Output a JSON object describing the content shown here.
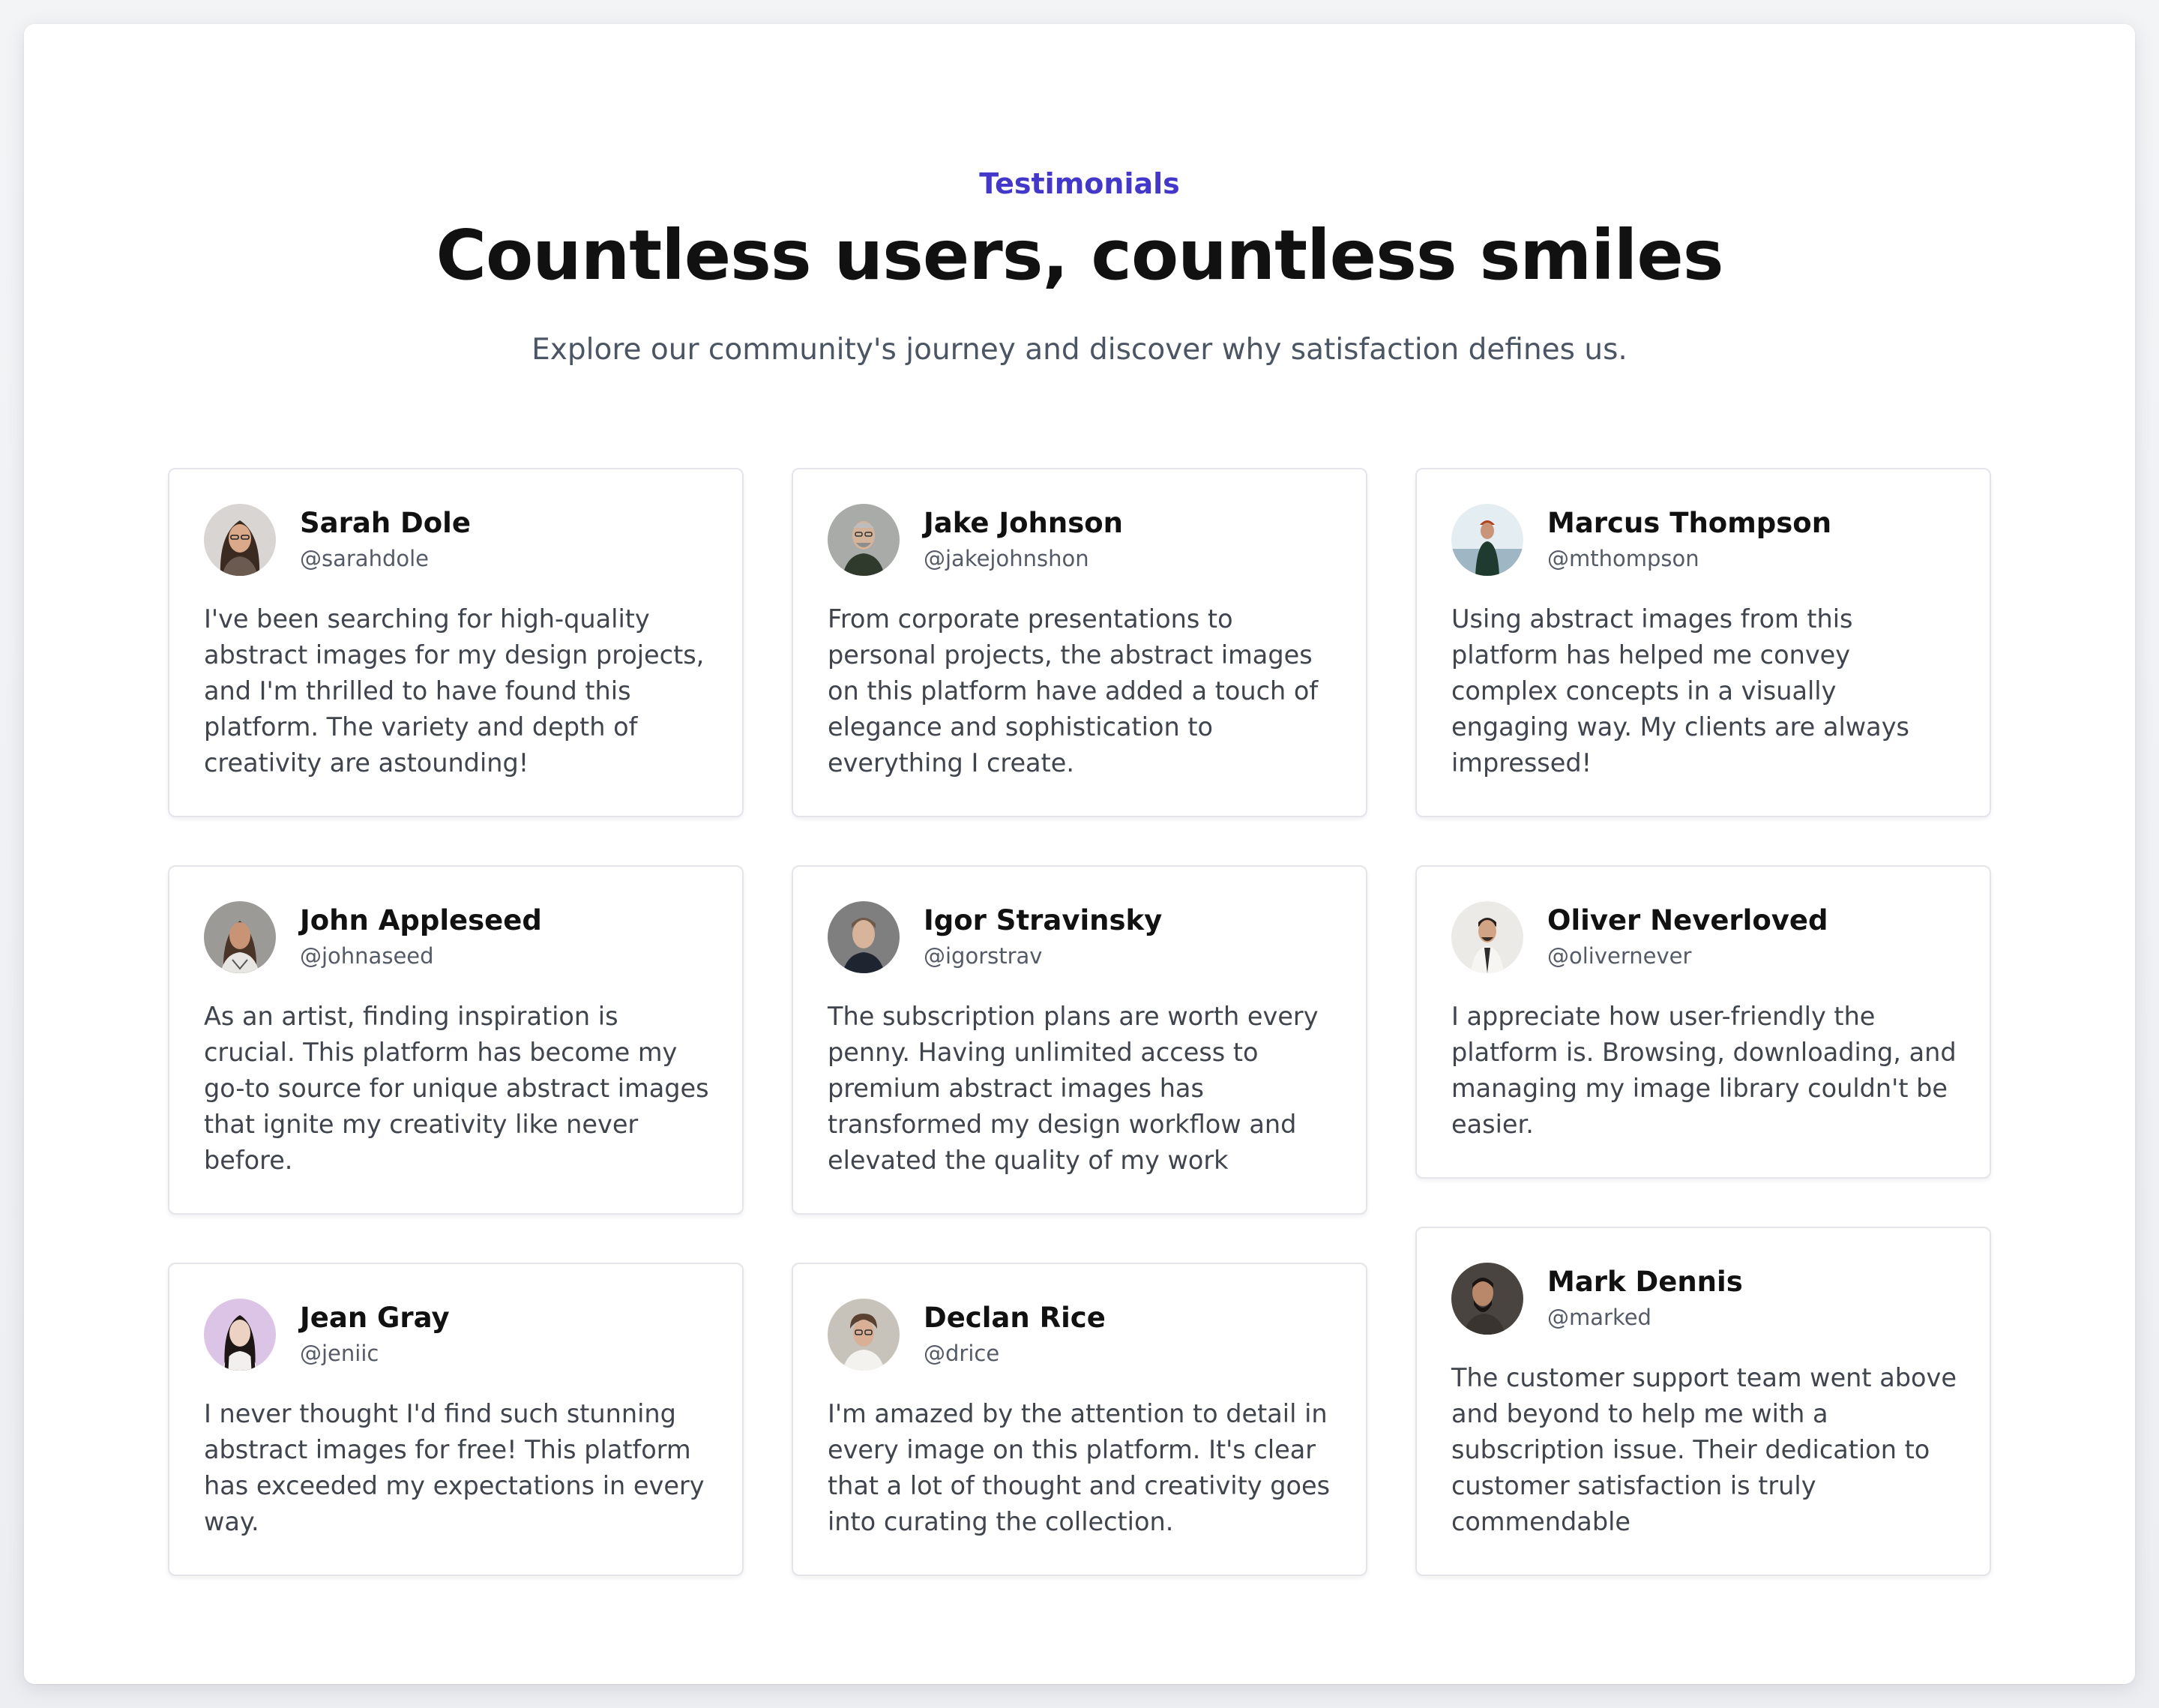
{
  "header": {
    "eyebrow": "Testimonials",
    "title": "Countless users, countless smiles",
    "subtitle": "Explore our community's journey and discover why satisfaction defines us."
  },
  "colors": {
    "accent": "#4338ca",
    "heading": "#111111",
    "body_text": "#3f444d",
    "card_border": "#e3e5ea"
  },
  "testimonials": [
    {
      "name": "Sarah Dole",
      "handle": "@sarahdole",
      "quote": "I've been searching for high-quality abstract images for my design projects, and I'm thrilled to have found this platform. The variety and depth of creativity are astounding!",
      "avatar_icon": "avatar-photo-icon"
    },
    {
      "name": "John Appleseed",
      "handle": "@johnaseed",
      "quote": "As an artist, finding inspiration is crucial. This platform has become my go-to source for unique abstract images that ignite my creativity like never before.",
      "avatar_icon": "avatar-photo-icon"
    },
    {
      "name": "Jean Gray",
      "handle": "@jeniic",
      "quote": "I never thought I'd find such stunning abstract images for free! This platform has exceeded my expectations in every way.",
      "avatar_icon": "avatar-photo-icon"
    },
    {
      "name": "Jake Johnson",
      "handle": "@jakejohnshon",
      "quote": "From corporate presentations to personal projects, the abstract images on this platform have added a touch of elegance and sophistication to everything I create.",
      "avatar_icon": "avatar-photo-icon"
    },
    {
      "name": "Igor Stravinsky",
      "handle": "@igorstrav",
      "quote": "The subscription plans are worth every penny. Having unlimited access to premium abstract images has transformed my design workflow and elevated the quality of my work",
      "avatar_icon": "avatar-photo-icon"
    },
    {
      "name": "Declan Rice",
      "handle": "@drice",
      "quote": "I'm amazed by the attention to detail in every image on this platform. It's clear that a lot of thought and creativity goes into curating the collection.",
      "avatar_icon": "avatar-photo-icon"
    },
    {
      "name": "Marcus Thompson",
      "handle": "@mthompson",
      "quote": "Using abstract images from this platform has helped me convey complex concepts in a visually engaging way. My clients are always impressed!",
      "avatar_icon": "avatar-photo-icon"
    },
    {
      "name": "Oliver Neverloved",
      "handle": "@olivernever",
      "quote": "I appreciate how user-friendly the platform is. Browsing, downloading, and managing my image library couldn't be easier.",
      "avatar_icon": "avatar-photo-icon"
    },
    {
      "name": "Mark Dennis",
      "handle": "@marked",
      "quote": "The customer support team went above and beyond to help me with a subscription issue. Their dedication to customer satisfaction is truly commendable",
      "avatar_icon": "avatar-photo-icon"
    }
  ]
}
